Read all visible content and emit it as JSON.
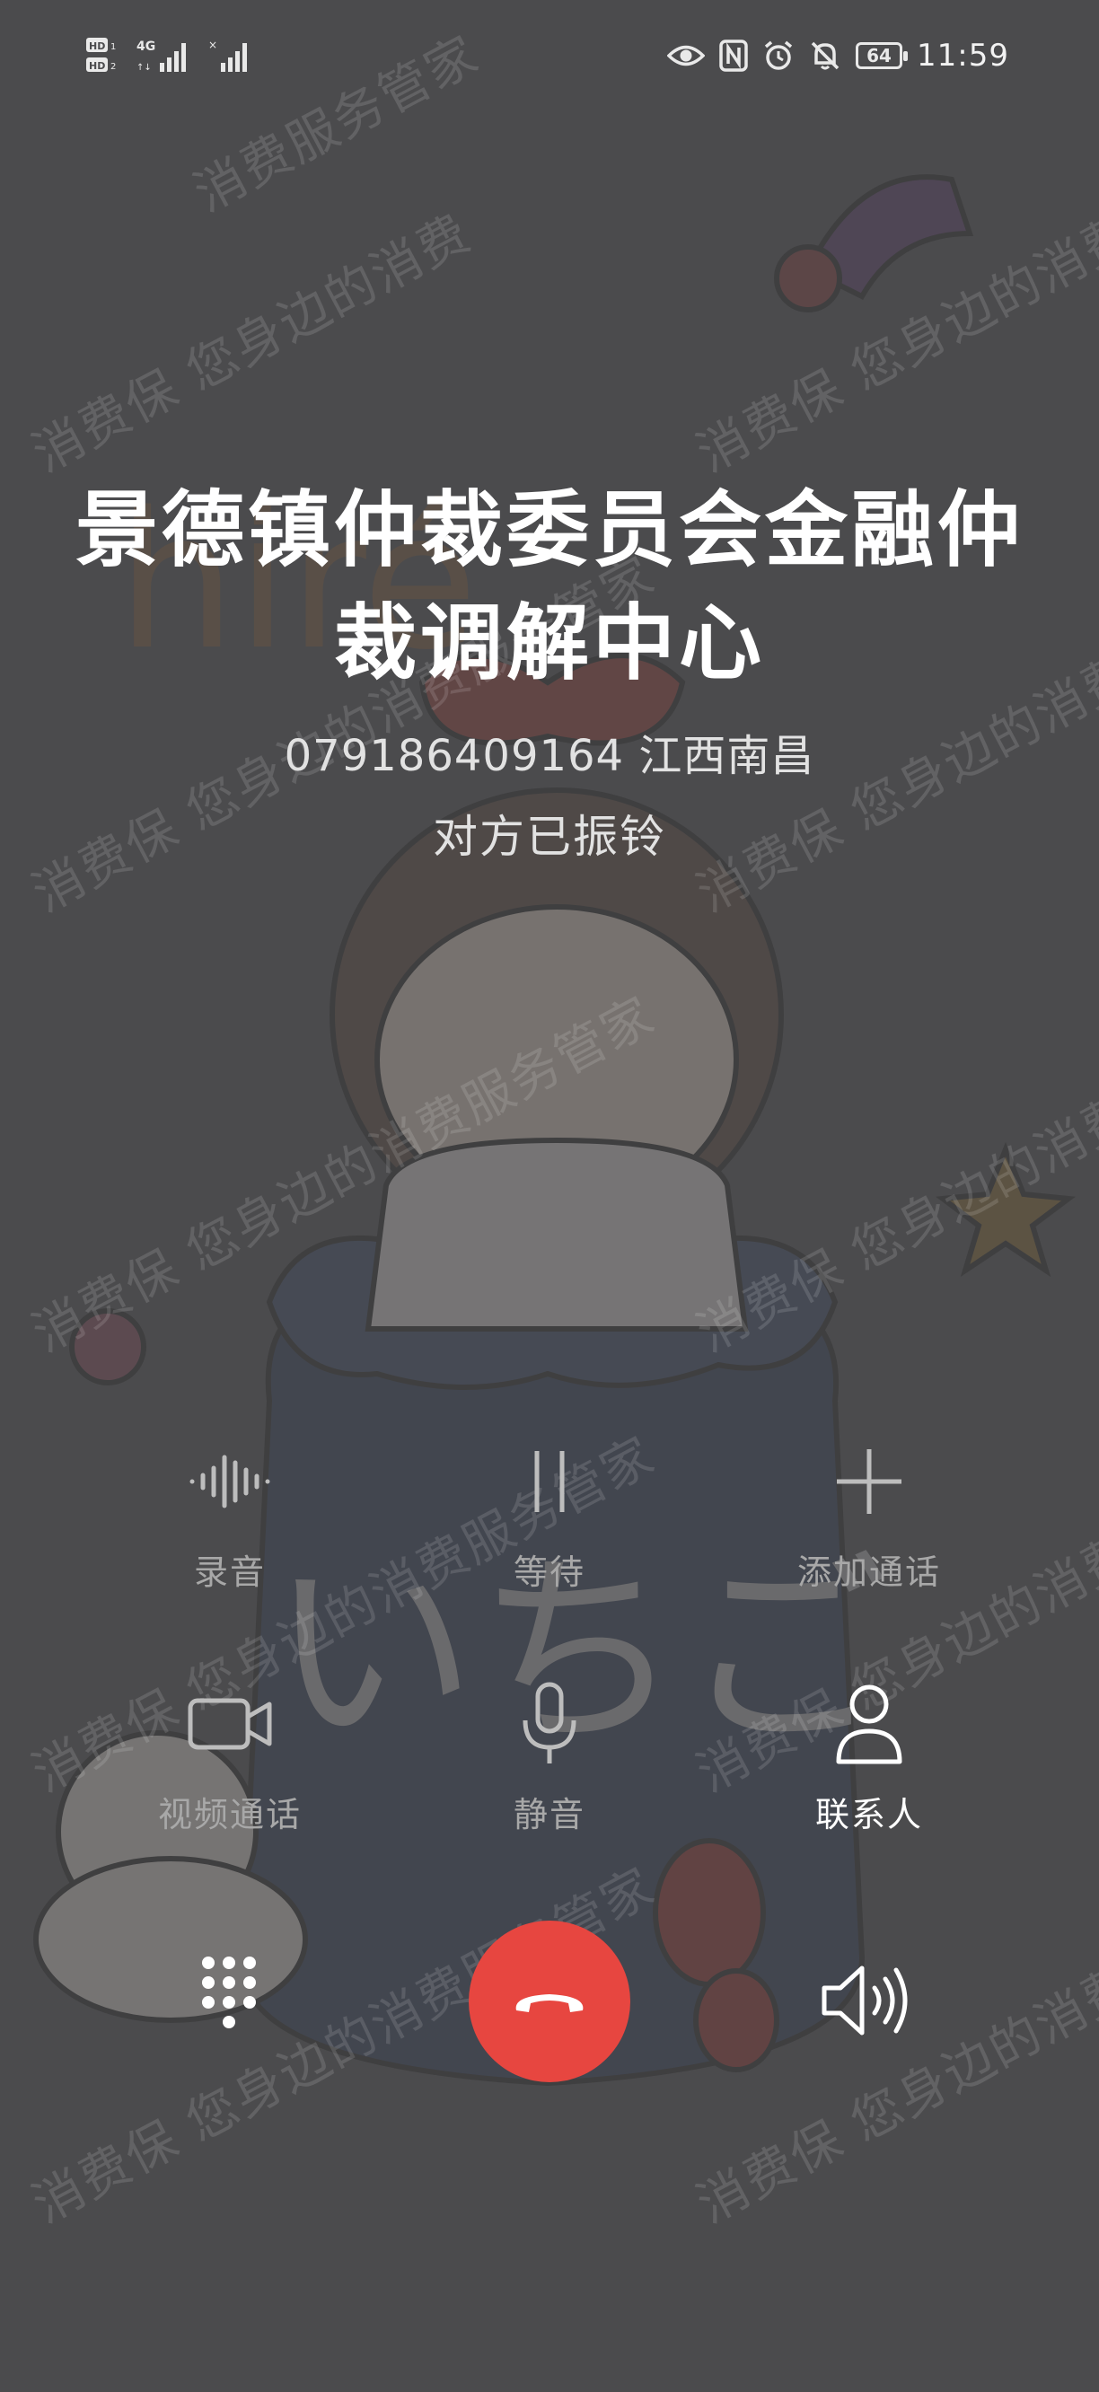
{
  "status_bar": {
    "time": "11:59",
    "battery": "64",
    "left_icons": [
      "hd-badge-icon",
      "4g-signal-icon",
      "signal-bars-icon"
    ],
    "right_icons": [
      "eye-comfort-icon",
      "nfc-icon",
      "alarm-icon",
      "mute-bell-icon",
      "battery-icon"
    ]
  },
  "call": {
    "caller_name": "景德镇仲裁委员会金融仲裁调解中心",
    "number_location": "079186409164 江西南昌",
    "status": "对方已振铃"
  },
  "actions": [
    {
      "label": "录音",
      "icon": "record-waveform-icon",
      "enabled": false
    },
    {
      "label": "等待",
      "icon": "pause-icon",
      "enabled": false
    },
    {
      "label": "添加通话",
      "icon": "plus-icon",
      "enabled": false
    },
    {
      "label": "视频通话",
      "icon": "video-camera-icon",
      "enabled": false
    },
    {
      "label": "静音",
      "icon": "microphone-icon",
      "enabled": false
    },
    {
      "label": "联系人",
      "icon": "contact-person-icon",
      "enabled": true
    }
  ],
  "controls": {
    "dialpad_icon": "dialpad-icon",
    "hangup_icon": "hangup-phone-icon",
    "speaker_icon": "speaker-icon"
  },
  "watermark": {
    "texts": [
      "消费保 您身边的消费",
      "消费保 您身边的消费服务管家",
      "消费服务管家"
    ]
  },
  "colors": {
    "background": "#4b4b4d",
    "hangup": "#e74640",
    "text": "#ffffff",
    "disabled_text": "#a8a8a8"
  }
}
